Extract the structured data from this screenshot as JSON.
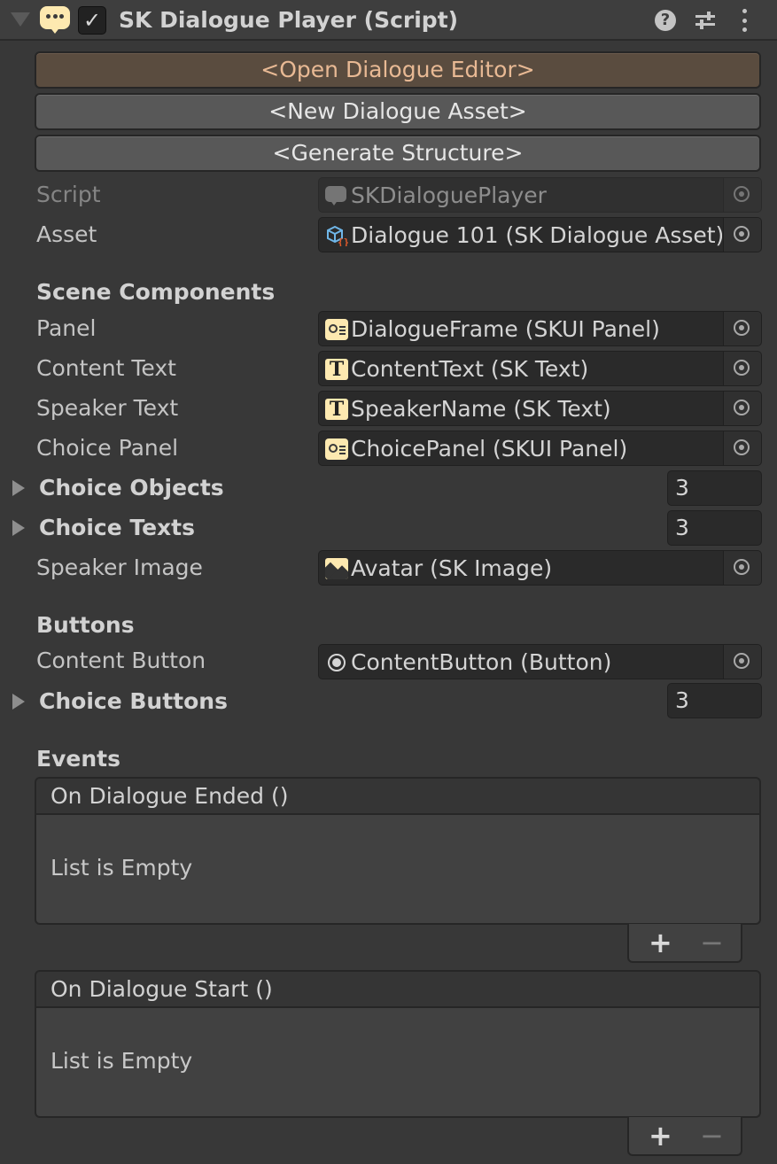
{
  "header": {
    "title": "SK Dialogue Player (Script)",
    "checkbox": "✓",
    "help": "?"
  },
  "buttons": {
    "open_editor": "<Open Dialogue Editor>",
    "new_asset": "<New Dialogue Asset>",
    "generate": "<Generate Structure>"
  },
  "fields": {
    "script": {
      "label": "Script",
      "value": "SKDialoguePlayer"
    },
    "asset": {
      "label": "Asset",
      "value": "Dialogue 101 (SK Dialogue Asset)"
    }
  },
  "scene_components": {
    "title": "Scene Components",
    "panel": {
      "label": "Panel",
      "value": "DialogueFrame (SKUI Panel)"
    },
    "content_text": {
      "label": "Content Text",
      "value": "ContentText (SK Text)"
    },
    "speaker_text": {
      "label": "Speaker Text",
      "value": "SpeakerName (SK Text)"
    },
    "choice_panel": {
      "label": "Choice Panel",
      "value": "ChoicePanel (SKUI Panel)"
    },
    "choice_objects": {
      "label": "Choice Objects",
      "count": "3"
    },
    "choice_texts": {
      "label": "Choice Texts",
      "count": "3"
    },
    "speaker_image": {
      "label": "Speaker Image",
      "value": "Avatar (SK Image)"
    }
  },
  "buttons_section": {
    "title": "Buttons",
    "content_button": {
      "label": "Content Button",
      "value": "ContentButton (Button)"
    },
    "choice_buttons": {
      "label": "Choice Buttons",
      "count": "3"
    }
  },
  "events": {
    "title": "Events",
    "items": [
      {
        "name": "On Dialogue Ended ()",
        "empty": "List is Empty",
        "add": "+",
        "remove": "−"
      },
      {
        "name": "On Dialogue Start ()",
        "empty": "List is Empty",
        "add": "+",
        "remove": "−"
      }
    ]
  },
  "colors": {
    "background": "#383838",
    "accent_button": "#5a4c3f",
    "accent_text": "#e8b994",
    "icon_yellow": "#fde9b0"
  }
}
